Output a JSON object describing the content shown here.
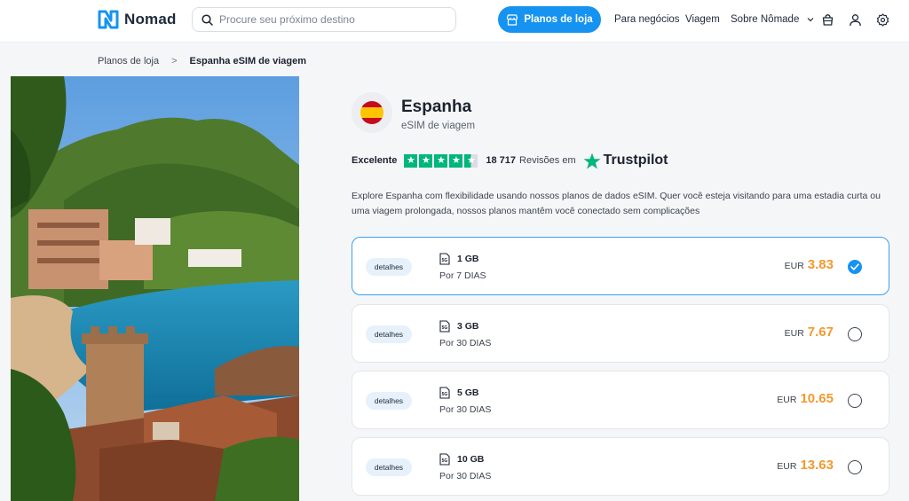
{
  "header": {
    "logo_text": "Nomad",
    "search_placeholder": "Procure seu próximo destino",
    "store_button": "Planos de loja",
    "nav": {
      "business": "Para negócios",
      "travel": "Viagem",
      "about": "Sobre Nômade"
    }
  },
  "breadcrumb": {
    "parent": "Planos de loja",
    "separator": ">",
    "current": "Espanha eSIM de viagem"
  },
  "product": {
    "country": "Espanha",
    "subtitle": "eSIM de viagem",
    "rating_word": "Excelente",
    "stars": 4.5,
    "review_count": "18 717",
    "review_word": "Revisões em",
    "trustpilot": "Trustpilot",
    "description": "Explore Espanha com flexibilidade usando nossos planos de dados eSIM. Quer você esteja visitando para uma estadia curta ou uma viagem prolongada, nossos planos mantêm você conectado sem complicações"
  },
  "plans": [
    {
      "details": "detalhes",
      "data": "1 GB",
      "period": "Por 7 DIAS",
      "currency": "EUR",
      "price": "3.83",
      "selected": true
    },
    {
      "details": "detalhes",
      "data": "3 GB",
      "period": "Por 30 DIAS",
      "currency": "EUR",
      "price": "7.67",
      "selected": false
    },
    {
      "details": "detalhes",
      "data": "5 GB",
      "period": "Por 30 DIAS",
      "currency": "EUR",
      "price": "10.65",
      "selected": false
    },
    {
      "details": "detalhes",
      "data": "10 GB",
      "period": "Por 30 DIAS",
      "currency": "EUR",
      "price": "13.63",
      "selected": false
    }
  ],
  "colors": {
    "accent": "#1693f0",
    "price": "#f29a2e",
    "trustpilot_green": "#00b67a"
  }
}
